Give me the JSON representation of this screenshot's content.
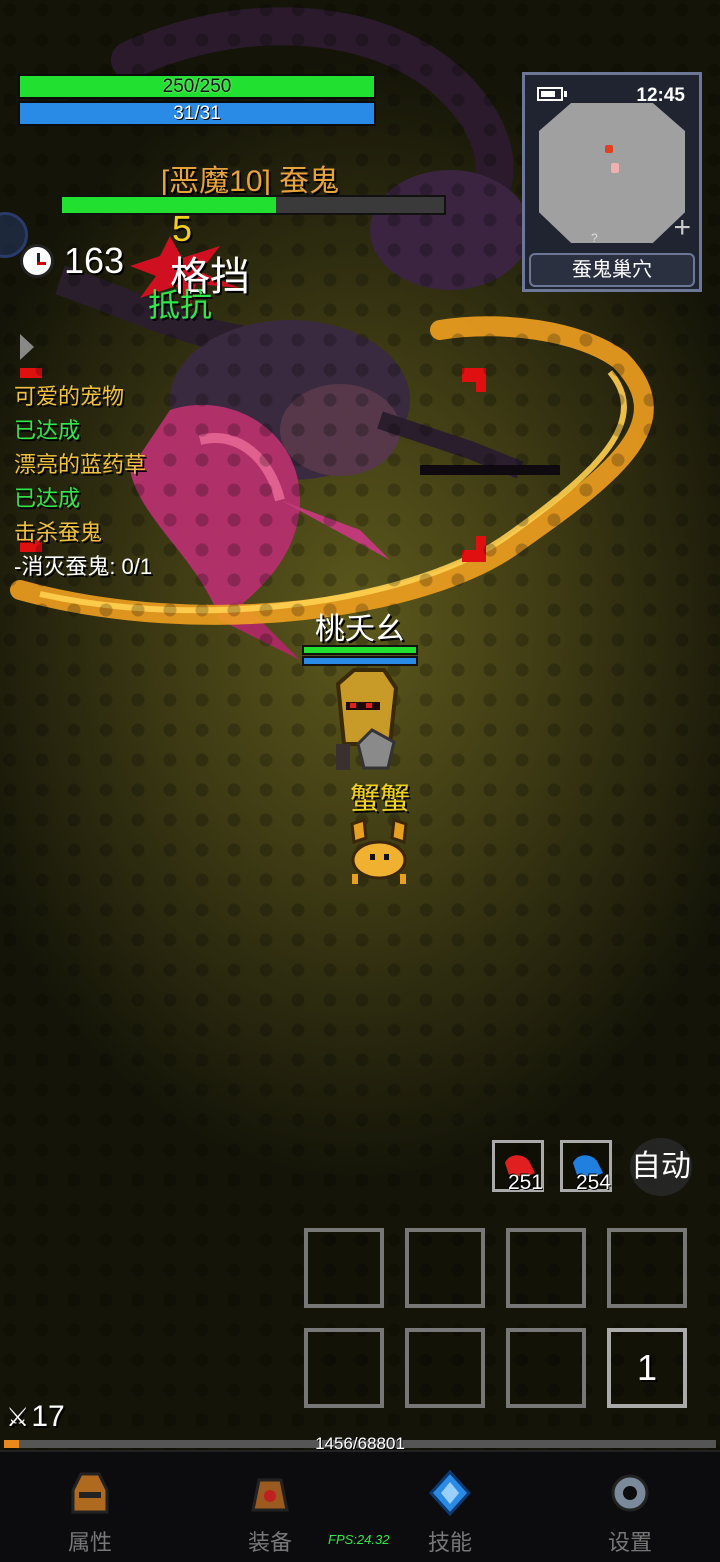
{
  "player": {
    "hp_text": "250/250",
    "mp_text": "31/31",
    "name": "桃夭幺"
  },
  "boss": {
    "name": "[恶魔10] 蚕鬼",
    "hp_fraction": 0.56
  },
  "timer": {
    "value": "163"
  },
  "combat_text": {
    "damage": "5",
    "block": "格挡",
    "resist": "抵抗"
  },
  "quests": [
    {
      "title": "可爱的宠物",
      "status": "已达成"
    },
    {
      "title": "漂亮的蓝药草",
      "status": "已达成"
    },
    {
      "title": "击杀蚕鬼",
      "status": "-消灭蚕鬼: 0/1"
    }
  ],
  "minimap": {
    "time": "12:45",
    "location": "蚕鬼巢穴",
    "plus": "+",
    "marker": "?"
  },
  "pet": {
    "name": "蟹蟹"
  },
  "potions": {
    "red_count": "251",
    "blue_count": "254"
  },
  "auto_label": "自动",
  "skill_slot_count": "1",
  "level": "17",
  "xp": {
    "text": "1456/68801",
    "fraction": 0.021
  },
  "nav": {
    "attributes": "属性",
    "equipment": "装备",
    "skills": "技能",
    "settings": "设置"
  },
  "fps": "FPS:24.32",
  "colors": {
    "hp": "#22e030",
    "mp": "#2a8be6",
    "boss_name": "#e8a23c",
    "quest_title": "#f0c040",
    "quest_done": "#2ee84a"
  }
}
